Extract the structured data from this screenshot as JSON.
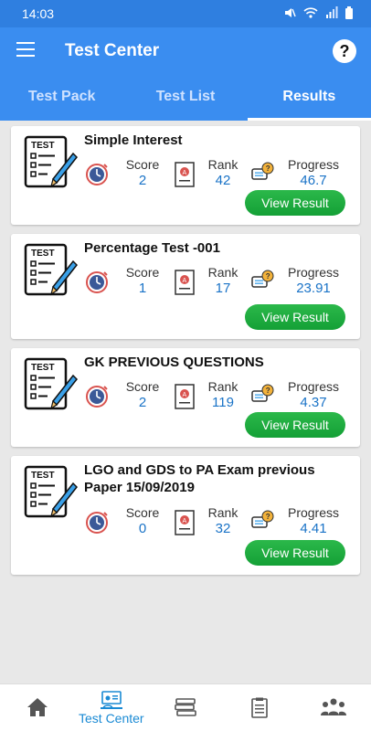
{
  "status_bar": {
    "time": "14:03"
  },
  "app_bar": {
    "title": "Test Center",
    "help_label": "?"
  },
  "tabs": [
    {
      "label": "Test Pack",
      "active": false
    },
    {
      "label": "Test List",
      "active": false
    },
    {
      "label": "Results",
      "active": true
    }
  ],
  "stat_labels": {
    "score": "Score",
    "rank": "Rank",
    "progress": "Progress"
  },
  "results": [
    {
      "name": "Simple Interest",
      "score": "2",
      "rank": "42",
      "progress": "46.7",
      "button": "View Result"
    },
    {
      "name": "Percentage Test -001",
      "score": "1",
      "rank": "17",
      "progress": "23.91",
      "button": "View Result"
    },
    {
      "name": "GK PREVIOUS QUESTIONS",
      "score": "2",
      "rank": "119",
      "progress": "4.37",
      "button": "View Result"
    },
    {
      "name": "LGO and GDS to PA Exam previous Paper 15/09/2019",
      "score": "0",
      "rank": "32",
      "progress": "4.41",
      "button": "View Result"
    }
  ],
  "test_thumb_text": "TEST",
  "bottom_nav": [
    {
      "icon": "home-icon",
      "label": "",
      "active": false
    },
    {
      "icon": "test-center-icon",
      "label": "Test Center",
      "active": true
    },
    {
      "icon": "book-stack-icon",
      "label": "",
      "active": false
    },
    {
      "icon": "document-list-icon",
      "label": "",
      "active": false
    },
    {
      "icon": "group-icon",
      "label": "",
      "active": false
    }
  ],
  "colors": {
    "primary": "#3a8df0",
    "accent_green": "#14a036",
    "value_blue": "#1a73c7"
  }
}
